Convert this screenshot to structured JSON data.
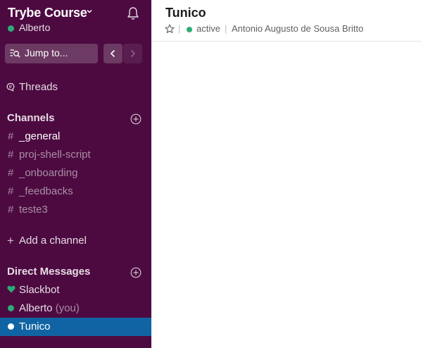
{
  "workspace": {
    "name": "Trybe Course",
    "user": "Alberto",
    "user_status_color": "#2bac76"
  },
  "jump": {
    "label": "Jump to..."
  },
  "nav": {
    "threads": "Threads"
  },
  "channels": {
    "title": "Channels",
    "items": [
      {
        "hash": "#",
        "label": "_general",
        "style": "bright"
      },
      {
        "hash": "#",
        "label": "proj-shell-script",
        "style": "dim"
      },
      {
        "hash": "#",
        "label": "_onboarding",
        "style": "dim"
      },
      {
        "hash": "#",
        "label": "_feedbacks",
        "style": "dim"
      },
      {
        "hash": "#",
        "label": "teste3",
        "style": "dim"
      }
    ],
    "add_label": "Add a channel",
    "add_symbol": "+"
  },
  "dms": {
    "title": "Direct Messages",
    "items": [
      {
        "label": "Slackbot",
        "icon": "heart-icon"
      },
      {
        "label": "Alberto",
        "suffix": "(you)",
        "icon": "presence-dot-active"
      },
      {
        "label": "Tunico",
        "icon": "presence-dot-active",
        "selected": true
      }
    ]
  },
  "conversation": {
    "title": "Tunico",
    "separator": "|",
    "status": "active",
    "full_name": "Antonio Augusto de Sousa Britto"
  },
  "colors": {
    "sidebar": "#4d0a41",
    "selected": "#1164a3",
    "presence": "#2bac76"
  }
}
